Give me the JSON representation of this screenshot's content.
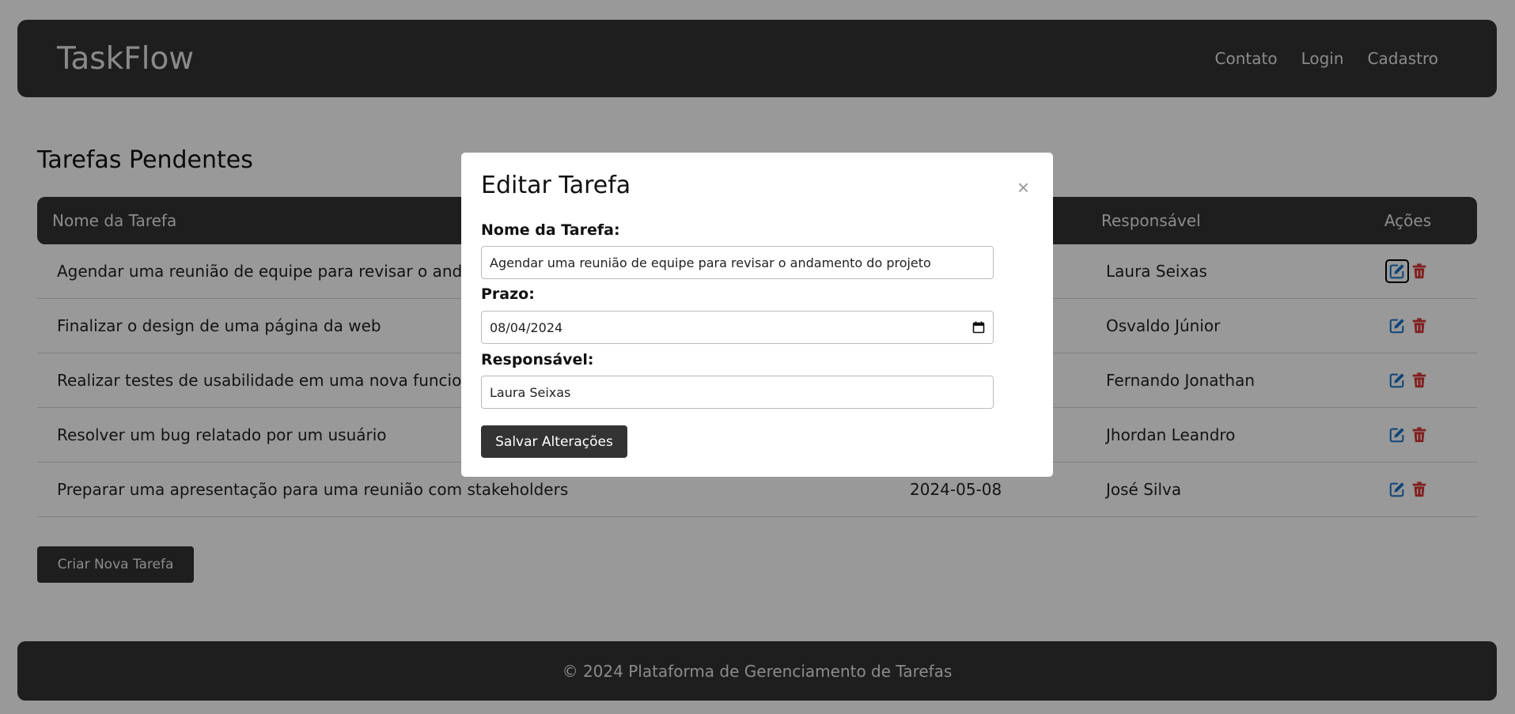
{
  "nav": {
    "brand": "TaskFlow",
    "links": [
      "Contato",
      "Login",
      "Cadastro"
    ]
  },
  "page": {
    "title": "Tarefas Pendentes",
    "create_button": "Criar Nova Tarefa"
  },
  "table": {
    "headers": {
      "name": "Nome da Tarefa",
      "responsible": "Responsável",
      "actions": "Ações"
    },
    "rows": [
      {
        "name": "Agendar uma reunião de equipe para revisar o andamento do projeto",
        "deadline": "",
        "responsible": "Laura Seixas"
      },
      {
        "name": "Finalizar o design de uma página da web",
        "deadline": "",
        "responsible": "Osvaldo Júnior"
      },
      {
        "name": "Realizar testes de usabilidade em uma nova funcionalidade",
        "deadline": "",
        "responsible": "Fernando Jonathan"
      },
      {
        "name": "Resolver um bug relatado por um usuário",
        "deadline": "",
        "responsible": "Jhordan Leandro"
      },
      {
        "name": "Preparar uma apresentação para uma reunião com stakeholders",
        "deadline": "2024-05-08",
        "responsible": "José Silva"
      }
    ],
    "action_icons": [
      "edit-icon",
      "trash-icon"
    ]
  },
  "footer": {
    "text": "© 2024 Plataforma de Gerenciamento de Tarefas"
  },
  "modal": {
    "title": "Editar Tarefa",
    "close": "×",
    "name_label": "Nome da Tarefa:",
    "name_value": "Agendar uma reunião de equipe para revisar o andamento do projeto",
    "deadline_label": "Prazo:",
    "deadline_value": "08/04/2024",
    "responsible_label": "Responsável:",
    "responsible_value": "Laura Seixas",
    "save_button": "Salvar Alterações"
  },
  "colors": {
    "dark": "#333333",
    "edit_icon": "#1a73c9",
    "delete_icon": "#d83535"
  }
}
